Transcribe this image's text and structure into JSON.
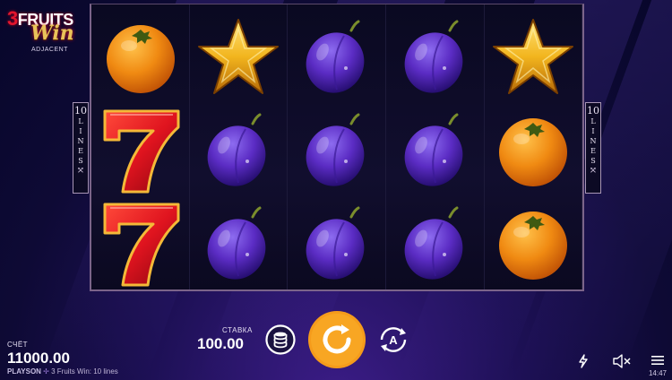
{
  "game": {
    "logo_number": "3",
    "logo_line1": "FRUITS",
    "logo_line2": "Win",
    "logo_sub": "ADJACENT"
  },
  "lines_indicator": {
    "count": "10",
    "word": [
      "L",
      "I",
      "N",
      "E",
      "S"
    ]
  },
  "reels": [
    [
      "orange",
      "seven",
      "seven"
    ],
    [
      "star",
      "plum",
      "plum"
    ],
    [
      "plum",
      "plum",
      "plum"
    ],
    [
      "plum",
      "plum",
      "plum"
    ],
    [
      "star",
      "orange",
      "orange"
    ]
  ],
  "footer": {
    "balance_label": "СЧЁТ",
    "balance_value": "11000.00",
    "provider_brand": "PLAYSON",
    "game_info": "3 Fruits Win: 10 lines",
    "bet_label": "СТАВКА",
    "bet_value": "100.00",
    "time": "14:47"
  },
  "colors": {
    "spin_button": "#f59b1b",
    "seven_red": "#e0141f",
    "plum_purple": "#5b2cc4",
    "orange": "#f08a12",
    "star_gold": "#f2b51e"
  },
  "icons": [
    "coins-stack-icon",
    "spin-arrow-icon",
    "autoplay-icon",
    "turbo-lightning-icon",
    "sound-muted-icon",
    "menu-hamburger-icon"
  ]
}
